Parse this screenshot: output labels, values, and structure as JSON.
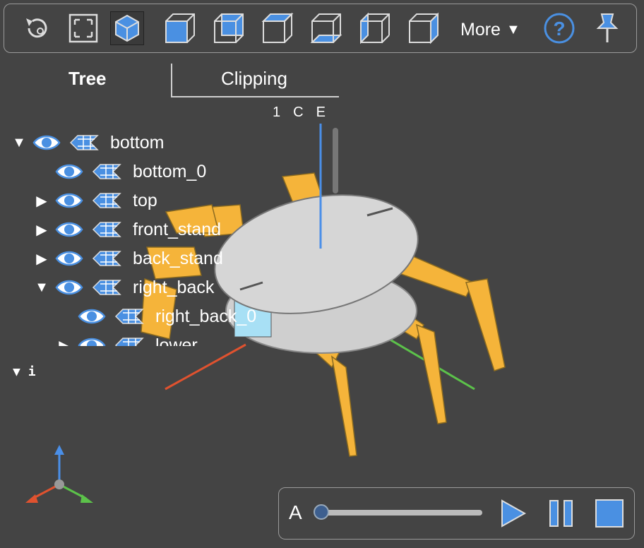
{
  "toolbar": {
    "buttons": [
      {
        "name": "reset-icon"
      },
      {
        "name": "resize-icon"
      },
      {
        "name": "iso-view-icon"
      },
      {
        "name": "front-view-icon"
      },
      {
        "name": "rear-view-icon"
      },
      {
        "name": "top-view-icon"
      },
      {
        "name": "bottom-view-icon"
      },
      {
        "name": "left-view-icon"
      },
      {
        "name": "right-view-icon"
      }
    ],
    "more_label": "More",
    "more_caret": "▼",
    "help_icon": "help-icon",
    "pin_icon": "pin-icon"
  },
  "tabs": {
    "tree": "Tree",
    "clipping": "Clipping"
  },
  "axis_labels": {
    "one": "1",
    "c": "C",
    "e": "E"
  },
  "tree": {
    "rows": [
      {
        "label": "bottom",
        "arrow": "▼"
      },
      {
        "label": "bottom_0",
        "arrow": ""
      },
      {
        "label": "top",
        "arrow": "▶"
      },
      {
        "label": "front_stand",
        "arrow": "▶"
      },
      {
        "label": "back_stand",
        "arrow": "▶"
      },
      {
        "label": "right_back",
        "arrow": "▼"
      },
      {
        "label": "right_back_0",
        "arrow": ""
      },
      {
        "label": "lower",
        "arrow": "▶"
      }
    ]
  },
  "topics": {
    "arrow": "▼",
    "label": "i"
  },
  "animation": {
    "label": "A",
    "position": 0,
    "controls": [
      "play-icon",
      "pause-icon",
      "stop-icon"
    ]
  },
  "colors": {
    "accent": "#4a90e2",
    "part": "#f5b43a",
    "body": "#d8d8d8",
    "x_axis": "#e0522f",
    "y_axis": "#5cc24a",
    "z_axis": "#4a8fe8"
  }
}
